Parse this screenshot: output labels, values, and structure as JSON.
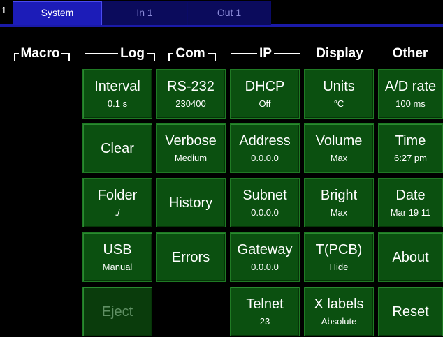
{
  "tabbar": {
    "page_number": "1",
    "tabs": [
      {
        "label": "System",
        "active": true
      },
      {
        "label": "In 1",
        "active": false
      },
      {
        "label": "Out 1",
        "active": false
      }
    ]
  },
  "columns": {
    "macro": "Macro",
    "log": "Log",
    "com": "Com",
    "ip": "IP",
    "display": "Display",
    "other": "Other"
  },
  "buttons": {
    "log_interval": {
      "label": "Interval",
      "value": "0.1 s"
    },
    "log_clear": {
      "label": "Clear"
    },
    "log_folder": {
      "label": "Folder",
      "value": "./"
    },
    "log_usb": {
      "label": "USB",
      "value": "Manual"
    },
    "log_eject": {
      "label": "Eject",
      "disabled": true
    },
    "com_rs232": {
      "label": "RS-232",
      "value": "230400"
    },
    "com_verbose": {
      "label": "Verbose",
      "value": "Medium"
    },
    "com_history": {
      "label": "History"
    },
    "com_errors": {
      "label": "Errors"
    },
    "ip_dhcp": {
      "label": "DHCP",
      "value": "Off"
    },
    "ip_address": {
      "label": "Address",
      "value": "0.0.0.0"
    },
    "ip_subnet": {
      "label": "Subnet",
      "value": "0.0.0.0"
    },
    "ip_gateway": {
      "label": "Gateway",
      "value": "0.0.0.0"
    },
    "ip_telnet": {
      "label": "Telnet",
      "value": "23"
    },
    "display_units": {
      "label": "Units",
      "value": "°C"
    },
    "display_volume": {
      "label": "Volume",
      "value": "Max"
    },
    "display_bright": {
      "label": "Bright",
      "value": "Max"
    },
    "display_tpcb": {
      "label": "T(PCB)",
      "value": "Hide"
    },
    "display_xlabels": {
      "label": "X labels",
      "value": "Absolute"
    },
    "other_adrate": {
      "label": "A/D rate",
      "value": "100 ms"
    },
    "other_time": {
      "label": "Time",
      "value": "6:27 pm"
    },
    "other_date": {
      "label": "Date",
      "value": "Mar 19 11"
    },
    "other_about": {
      "label": "About"
    },
    "other_reset": {
      "label": "Reset"
    }
  },
  "colors": {
    "button_bg": "#0b5010",
    "tab_active": "#1c1cb8",
    "tab_inactive": "#0b0b5c",
    "background": "#000000"
  }
}
